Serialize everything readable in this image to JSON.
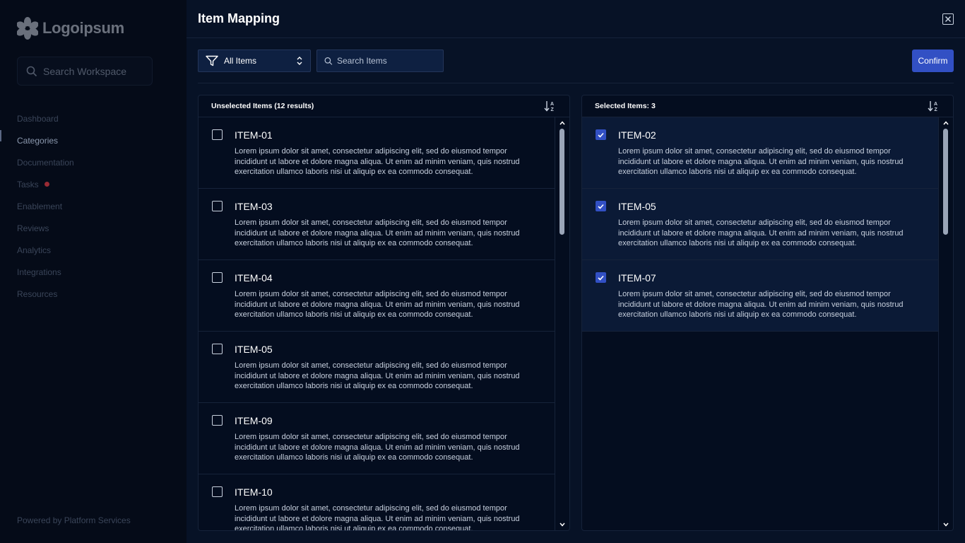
{
  "app": {
    "logo_text": "Logoipsum",
    "workspace_search_placeholder": "Search Workspace",
    "footer": "Powered by Platform Services"
  },
  "sidebar": {
    "items": [
      {
        "label": "Dashboard"
      },
      {
        "label": "Categories",
        "active": true
      },
      {
        "label": "Documentation"
      },
      {
        "label": "Tasks",
        "has_dot": true
      },
      {
        "label": "Enablement"
      },
      {
        "label": "Reviews"
      },
      {
        "label": "Analytics"
      },
      {
        "label": "Integrations"
      },
      {
        "label": "Resources"
      }
    ]
  },
  "modal": {
    "title": "Item Mapping",
    "filter_label": "All Items",
    "search_placeholder": "Search Items",
    "confirm_label": "Confirm",
    "unselected_title": "Unselected Items (12 results)",
    "selected_title": "Selected Items: 3",
    "description": "Lorem ipsum dolor sit amet, consectetur adipiscing elit, sed do eiusmod tempor incididunt ut labore et dolore magna aliqua. Ut enim ad minim veniam, quis nostrud exercitation ullamco laboris nisi ut aliquip ex ea commodo consequat.",
    "unselected_items": [
      "ITEM-01",
      "ITEM-03",
      "ITEM-04",
      "ITEM-05",
      "ITEM-09",
      "ITEM-10"
    ],
    "selected_items": [
      "ITEM-02",
      "ITEM-05",
      "ITEM-07"
    ]
  },
  "colors": {
    "accent": "#3250c4",
    "background": "#071226",
    "alert_dot": "#9a2b34"
  },
  "icons": {
    "logo": "flower-logo-icon",
    "search": "search-icon",
    "filter": "filter-icon",
    "chevron": "chevron-up-down-icon",
    "sort": "sort-az-icon",
    "close": "close-icon",
    "check": "check-icon"
  }
}
